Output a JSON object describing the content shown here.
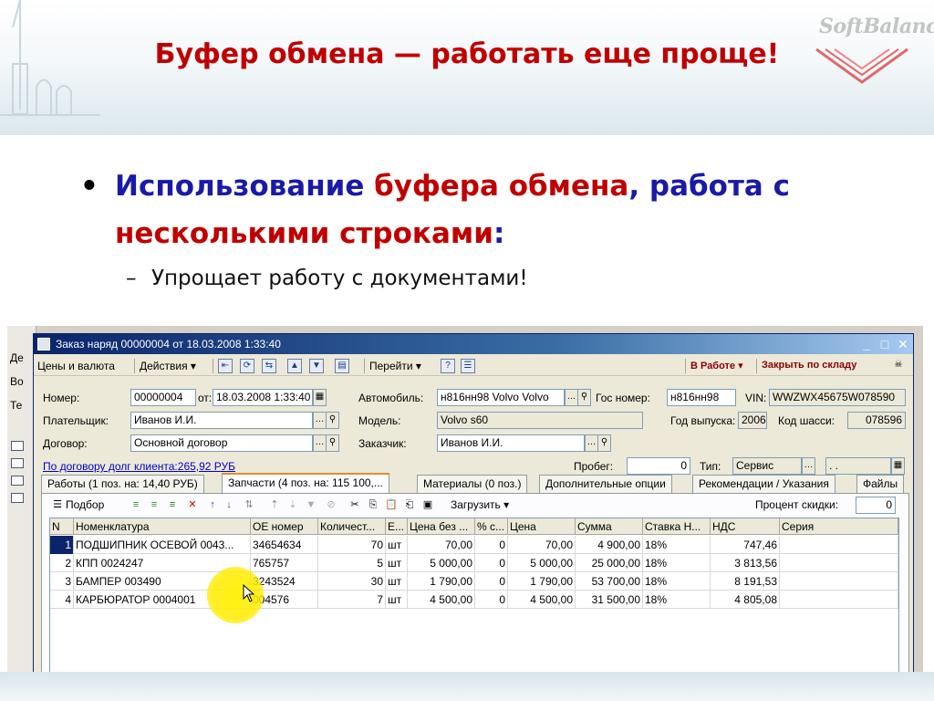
{
  "slide": {
    "title": "Буфер обмена — работать еще проще!",
    "logo_text": "SoftBalance",
    "bullet": {
      "part1": "Использование ",
      "part2": "буфера обмена",
      "part3": ", работа с ",
      "part4": "несколькими строками",
      "part5": ":"
    },
    "sub_bullet": "Упрощает работу с документами!"
  },
  "background_window": {
    "items": [
      "Де",
      "Во",
      "Те"
    ]
  },
  "window": {
    "title": "Заказ наряд 00000004 от 18.03.2008 1:33:40",
    "menu": {
      "prices": "Цены и валюта",
      "actions": "Действия",
      "goto": "Перейти",
      "help": "?",
      "status": "В Работе",
      "close_stock": "Закрыть по складу"
    },
    "form": {
      "number_label": "Номер:",
      "number_value": "00000004",
      "from_label": "от:",
      "date_value": "18.03.2008 1:33:40",
      "car_label": "Автомобиль:",
      "car_value": "н816нн98 Volvo Volvo",
      "gos_label": "Гос номер:",
      "gos_value": "н816нн98",
      "vin_label": "VIN:",
      "vin_value": "WWZWX45675W078590",
      "payer_label": "Плательщик:",
      "payer_value": "Иванов И.И.",
      "model_label": "Модель:",
      "model_value": "Volvo s60",
      "year_label": "Год выпуска:",
      "year_value": "2006",
      "chassis_label": "Код шасси:",
      "chassis_value": "078596",
      "contract_label": "Договор:",
      "contract_value": "Основной договор",
      "customer_label": "Заказчик:",
      "customer_value": "Иванов И.И.",
      "debt_link": "По договору долг клиента:265,92 РУБ",
      "mileage_label": "Пробег:",
      "mileage_value": "0",
      "type_label": "Тип:",
      "type_value": "Сервис",
      "date_empty": " .  ."
    },
    "tabs": [
      "Работы (1 поз. на: 14,40 РУБ)",
      "Запчасти (4 поз. на: 115 100,...",
      "Материалы (0 поз.)",
      "Дополнительные опции",
      "Рекомендации / Указания",
      "Файлы"
    ],
    "toolbar": {
      "pick": "Подбор",
      "load": "Загрузить",
      "discount_label": "Процент скидки:",
      "discount_value": "0"
    },
    "grid": {
      "columns": [
        "N",
        "Номенклатура",
        "ОЕ номер",
        "Количест...",
        "Е...",
        "Цена без ...",
        "% с...",
        "Цена",
        "Сумма",
        "Ставка Н...",
        "НДС",
        "Серия"
      ],
      "rows": [
        [
          "1",
          "ПОДШИПНИК ОСЕВОЙ 0043...",
          "34654634",
          "70",
          "шт",
          "70,00",
          "0",
          "70,00",
          "4 900,00",
          "18%",
          "747,46",
          ""
        ],
        [
          "2",
          "КПП 0024247",
          "765757",
          "5",
          "шт",
          "5 000,00",
          "0",
          "5 000,00",
          "25 000,00",
          "18%",
          "3 813,56",
          ""
        ],
        [
          "3",
          "БАМПЕР 003490",
          "3243524",
          "30",
          "шт",
          "1 790,00",
          "0",
          "1 790,00",
          "53 700,00",
          "18%",
          "8 191,53",
          ""
        ],
        [
          "4",
          "КАРБЮРАТОР 0004001",
          "004576",
          "7",
          "шт",
          "4 500,00",
          "0",
          "4 500,00",
          "31 500,00",
          "18%",
          "4 805,08",
          ""
        ]
      ]
    }
  },
  "colors": {
    "title_red": "#c00000",
    "bullet_blue": "#1a1aa8",
    "win_title": "#0a246a"
  }
}
